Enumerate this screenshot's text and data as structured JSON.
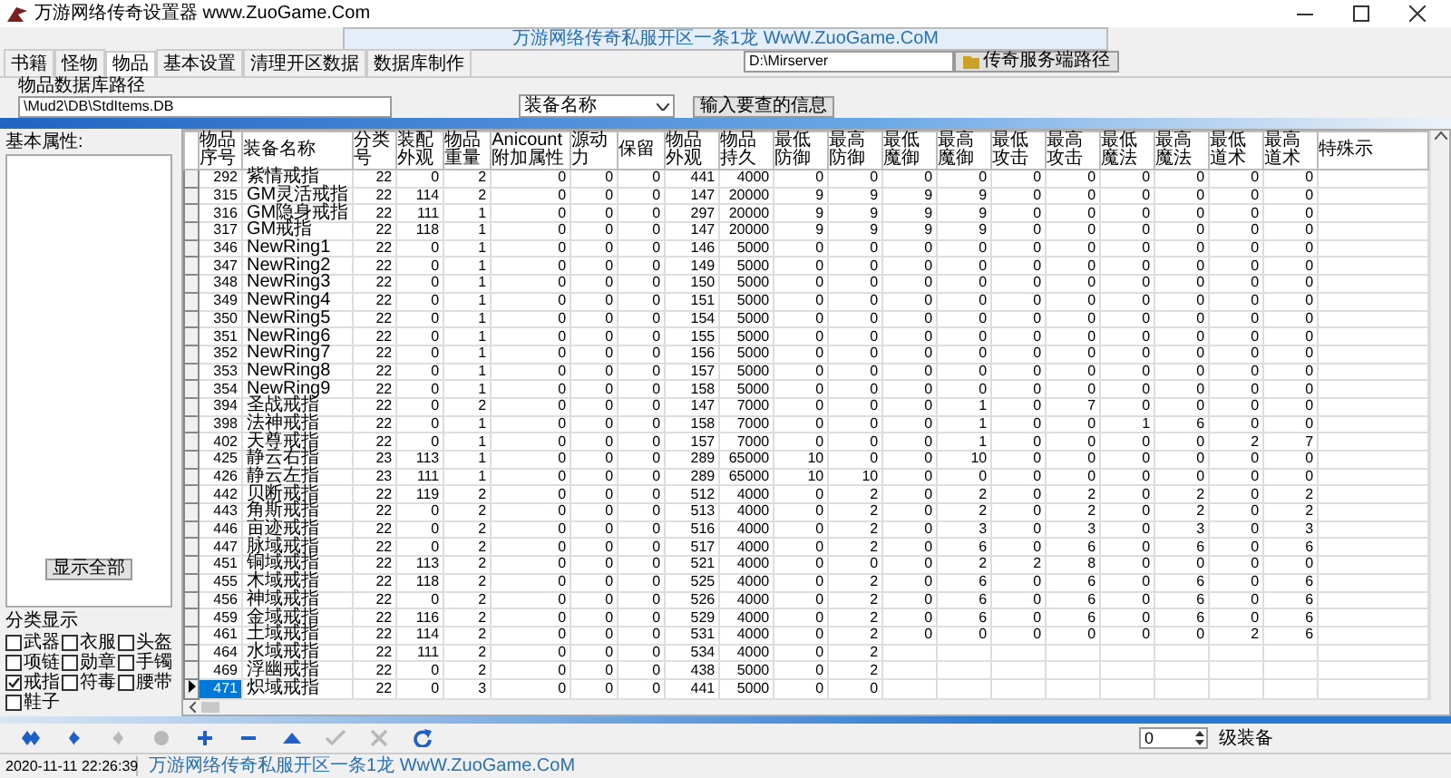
{
  "window": {
    "title": "万游网络传奇设置器 www.ZuoGame.Com"
  },
  "banner": "万游网络传奇私服开区一条1龙 WwW.ZuoGame.CoM",
  "tabs": [
    {
      "label": "书籍",
      "selected": false
    },
    {
      "label": "怪物",
      "selected": false
    },
    {
      "label": "物品",
      "selected": true
    },
    {
      "label": "基本设置",
      "selected": false
    },
    {
      "label": "清理开区数据",
      "selected": false
    },
    {
      "label": "数据库制作",
      "selected": false
    }
  ],
  "server_path": {
    "value": "D:\\Mirserver",
    "button": "传奇服务端路径"
  },
  "item_db": {
    "label": "物品数据库路径",
    "value": "\\Mud2\\DB\\StdItems.DB",
    "dropdown": "装备名称",
    "button": "输入要查的信息"
  },
  "left_panel": {
    "label": "基本属性:",
    "show_all_button": "显示全部",
    "category_label": "分类显示",
    "categories": [
      {
        "label": "武器",
        "checked": false
      },
      {
        "label": "衣服",
        "checked": false
      },
      {
        "label": "头盔",
        "checked": false
      },
      {
        "label": "项链",
        "checked": false
      },
      {
        "label": "勋章",
        "checked": false
      },
      {
        "label": "手镯",
        "checked": false
      },
      {
        "label": "戒指",
        "checked": true
      },
      {
        "label": "符毒",
        "checked": false
      },
      {
        "label": "腰带",
        "checked": false
      },
      {
        "label": "鞋子",
        "checked": false
      }
    ]
  },
  "table": {
    "columns": [
      "物品序号",
      "装备名称",
      "分类号",
      "装配外观",
      "物品重量",
      "Anicount附加属性",
      "源动力",
      "保留",
      "物品外观",
      "物品持久",
      "最低防御",
      "最高防御",
      "最低魔御",
      "最高魔御",
      "最低攻击",
      "最高攻击",
      "最低魔法",
      "最高魔法",
      "最低道术",
      "最高道术",
      "特殊示"
    ],
    "rows": [
      {
        "selected": false,
        "cells": [
          "292",
          "紫情戒指",
          "22",
          "0",
          "2",
          "0",
          "0",
          "0",
          "441",
          "4000",
          "0",
          "0",
          "0",
          "0",
          "0",
          "0",
          "0",
          "0",
          "0",
          "0"
        ]
      },
      {
        "selected": false,
        "cells": [
          "315",
          "GM灵活戒指",
          "22",
          "114",
          "2",
          "0",
          "0",
          "0",
          "147",
          "20000",
          "9",
          "9",
          "9",
          "9",
          "0",
          "0",
          "0",
          "0",
          "0",
          "0"
        ]
      },
      {
        "selected": false,
        "cells": [
          "316",
          "GM隐身戒指",
          "22",
          "111",
          "1",
          "0",
          "0",
          "0",
          "297",
          "20000",
          "9",
          "9",
          "9",
          "9",
          "0",
          "0",
          "0",
          "0",
          "0",
          "0"
        ]
      },
      {
        "selected": false,
        "cells": [
          "317",
          "GM戒指",
          "22",
          "118",
          "1",
          "0",
          "0",
          "0",
          "147",
          "20000",
          "9",
          "9",
          "9",
          "9",
          "0",
          "0",
          "0",
          "0",
          "0",
          "0"
        ]
      },
      {
        "selected": false,
        "cells": [
          "346",
          "NewRing1",
          "22",
          "0",
          "1",
          "0",
          "0",
          "0",
          "146",
          "5000",
          "0",
          "0",
          "0",
          "0",
          "0",
          "0",
          "0",
          "0",
          "0",
          "0"
        ]
      },
      {
        "selected": false,
        "cells": [
          "347",
          "NewRing2",
          "22",
          "0",
          "1",
          "0",
          "0",
          "0",
          "149",
          "5000",
          "0",
          "0",
          "0",
          "0",
          "0",
          "0",
          "0",
          "0",
          "0",
          "0"
        ]
      },
      {
        "selected": false,
        "cells": [
          "348",
          "NewRing3",
          "22",
          "0",
          "1",
          "0",
          "0",
          "0",
          "150",
          "5000",
          "0",
          "0",
          "0",
          "0",
          "0",
          "0",
          "0",
          "0",
          "0",
          "0"
        ]
      },
      {
        "selected": false,
        "cells": [
          "349",
          "NewRing4",
          "22",
          "0",
          "1",
          "0",
          "0",
          "0",
          "151",
          "5000",
          "0",
          "0",
          "0",
          "0",
          "0",
          "0",
          "0",
          "0",
          "0",
          "0"
        ]
      },
      {
        "selected": false,
        "cells": [
          "350",
          "NewRing5",
          "22",
          "0",
          "1",
          "0",
          "0",
          "0",
          "154",
          "5000",
          "0",
          "0",
          "0",
          "0",
          "0",
          "0",
          "0",
          "0",
          "0",
          "0"
        ]
      },
      {
        "selected": false,
        "cells": [
          "351",
          "NewRing6",
          "22",
          "0",
          "1",
          "0",
          "0",
          "0",
          "155",
          "5000",
          "0",
          "0",
          "0",
          "0",
          "0",
          "0",
          "0",
          "0",
          "0",
          "0"
        ]
      },
      {
        "selected": false,
        "cells": [
          "352",
          "NewRing7",
          "22",
          "0",
          "1",
          "0",
          "0",
          "0",
          "156",
          "5000",
          "0",
          "0",
          "0",
          "0",
          "0",
          "0",
          "0",
          "0",
          "0",
          "0"
        ]
      },
      {
        "selected": false,
        "cells": [
          "353",
          "NewRing8",
          "22",
          "0",
          "1",
          "0",
          "0",
          "0",
          "157",
          "5000",
          "0",
          "0",
          "0",
          "0",
          "0",
          "0",
          "0",
          "0",
          "0",
          "0"
        ]
      },
      {
        "selected": false,
        "cells": [
          "354",
          "NewRing9",
          "22",
          "0",
          "1",
          "0",
          "0",
          "0",
          "158",
          "5000",
          "0",
          "0",
          "0",
          "0",
          "0",
          "0",
          "0",
          "0",
          "0",
          "0"
        ]
      },
      {
        "selected": false,
        "cells": [
          "394",
          "圣战戒指",
          "22",
          "0",
          "2",
          "0",
          "0",
          "0",
          "147",
          "7000",
          "0",
          "0",
          "0",
          "1",
          "0",
          "7",
          "0",
          "0",
          "0",
          "0"
        ]
      },
      {
        "selected": false,
        "cells": [
          "398",
          "法神戒指",
          "22",
          "0",
          "1",
          "0",
          "0",
          "0",
          "158",
          "7000",
          "0",
          "0",
          "0",
          "1",
          "0",
          "0",
          "1",
          "6",
          "0",
          "0"
        ]
      },
      {
        "selected": false,
        "cells": [
          "402",
          "天尊戒指",
          "22",
          "0",
          "1",
          "0",
          "0",
          "0",
          "157",
          "7000",
          "0",
          "0",
          "0",
          "1",
          "0",
          "0",
          "0",
          "0",
          "2",
          "7"
        ]
      },
      {
        "selected": false,
        "cells": [
          "425",
          "静云右指",
          "23",
          "113",
          "1",
          "0",
          "0",
          "0",
          "289",
          "65000",
          "10",
          "0",
          "0",
          "10",
          "0",
          "0",
          "0",
          "0",
          "0",
          "0"
        ]
      },
      {
        "selected": false,
        "cells": [
          "426",
          "静云左指",
          "23",
          "111",
          "1",
          "0",
          "0",
          "0",
          "289",
          "65000",
          "10",
          "10",
          "0",
          "0",
          "0",
          "0",
          "0",
          "0",
          "0",
          "0"
        ]
      },
      {
        "selected": false,
        "cells": [
          "442",
          "贝断戒指",
          "22",
          "119",
          "2",
          "0",
          "0",
          "0",
          "512",
          "4000",
          "0",
          "2",
          "0",
          "2",
          "0",
          "2",
          "0",
          "2",
          "0",
          "2"
        ]
      },
      {
        "selected": false,
        "cells": [
          "443",
          "角斯戒指",
          "22",
          "0",
          "2",
          "0",
          "0",
          "0",
          "513",
          "4000",
          "0",
          "2",
          "0",
          "2",
          "0",
          "2",
          "0",
          "2",
          "0",
          "2"
        ]
      },
      {
        "selected": false,
        "cells": [
          "446",
          "亩迹戒指",
          "22",
          "0",
          "2",
          "0",
          "0",
          "0",
          "516",
          "4000",
          "0",
          "2",
          "0",
          "3",
          "0",
          "3",
          "0",
          "3",
          "0",
          "3"
        ]
      },
      {
        "selected": false,
        "cells": [
          "447",
          "脉域戒指",
          "22",
          "0",
          "2",
          "0",
          "0",
          "0",
          "517",
          "4000",
          "0",
          "2",
          "0",
          "6",
          "0",
          "6",
          "0",
          "6",
          "0",
          "6"
        ]
      },
      {
        "selected": false,
        "cells": [
          "451",
          "铜域戒指",
          "22",
          "113",
          "2",
          "0",
          "0",
          "0",
          "521",
          "4000",
          "0",
          "0",
          "0",
          "2",
          "2",
          "8",
          "0",
          "0",
          "0",
          "0"
        ]
      },
      {
        "selected": false,
        "cells": [
          "455",
          "木域戒指",
          "22",
          "118",
          "2",
          "0",
          "0",
          "0",
          "525",
          "4000",
          "0",
          "2",
          "0",
          "6",
          "0",
          "6",
          "0",
          "6",
          "0",
          "6"
        ]
      },
      {
        "selected": false,
        "cells": [
          "456",
          "神域戒指",
          "22",
          "0",
          "2",
          "0",
          "0",
          "0",
          "526",
          "4000",
          "0",
          "2",
          "0",
          "6",
          "0",
          "6",
          "0",
          "6",
          "0",
          "6"
        ]
      },
      {
        "selected": false,
        "cells": [
          "459",
          "金域戒指",
          "22",
          "116",
          "2",
          "0",
          "0",
          "0",
          "529",
          "4000",
          "0",
          "2",
          "0",
          "6",
          "0",
          "6",
          "0",
          "6",
          "0",
          "6"
        ]
      },
      {
        "selected": false,
        "cells": [
          "461",
          "土域戒指",
          "22",
          "114",
          "2",
          "0",
          "0",
          "0",
          "531",
          "4000",
          "0",
          "2",
          "0",
          "0",
          "0",
          "0",
          "0",
          "0",
          "2",
          "6"
        ]
      },
      {
        "selected": false,
        "cells": [
          "464",
          "水域戒指",
          "22",
          "111",
          "2",
          "0",
          "0",
          "0",
          "534",
          "4000",
          "0",
          "2"
        ]
      },
      {
        "selected": false,
        "cells": [
          "469",
          "浮幽戒指",
          "22",
          "0",
          "2",
          "0",
          "0",
          "0",
          "438",
          "5000",
          "0",
          "2"
        ]
      },
      {
        "selected": true,
        "cells": [
          "471",
          "炽域戒指",
          "22",
          "0",
          "3",
          "0",
          "0",
          "0",
          "441",
          "5000",
          "0",
          "0"
        ]
      }
    ]
  },
  "navigator": {
    "buttons": [
      {
        "kind": "first",
        "disabled": false
      },
      {
        "kind": "prior",
        "disabled": false
      },
      {
        "kind": "next",
        "disabled": true
      },
      {
        "kind": "last",
        "disabled": true
      },
      {
        "kind": "insert",
        "disabled": false
      },
      {
        "kind": "delete",
        "disabled": false
      },
      {
        "kind": "edit",
        "disabled": false
      },
      {
        "kind": "post",
        "disabled": true
      },
      {
        "kind": "cancel",
        "disabled": true
      },
      {
        "kind": "refresh",
        "disabled": false
      }
    ],
    "spin_value": "0",
    "spin_label": "级装备"
  },
  "status_bar": {
    "time": "2020-11-11 22:26:39",
    "text": "万游网络传奇私服开区一条1龙 WwW.ZuoGame.CoM"
  }
}
